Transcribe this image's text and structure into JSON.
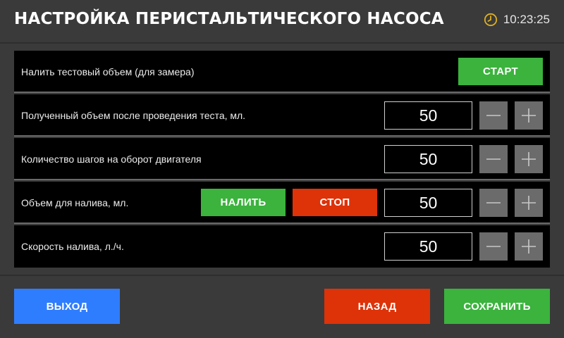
{
  "header": {
    "title": "НАСТРОЙКА ПЕРИСТАЛЬТИЧЕСКОГО НАСОСА",
    "time": "10:23:25",
    "clock_icon": "clock-icon",
    "clock_color": "#e0b020"
  },
  "rows": [
    {
      "label": "Налить тестовый объем (для замера)",
      "start_label": "СТАРТ"
    },
    {
      "label": "Полученный объем после проведения теста, мл.",
      "value": "50"
    },
    {
      "label": "Количество шагов на оборот двигателя",
      "value": "50"
    },
    {
      "label": "Объем для налива, мл.",
      "value": "50",
      "pour_label": "НАЛИТЬ",
      "stop_label": "СТОП"
    },
    {
      "label": "Скорость налива, л./ч.",
      "value": "50"
    }
  ],
  "footer": {
    "exit_label": "ВЫХОД",
    "back_label": "НАЗАД",
    "save_label": "СОХРАНИТЬ"
  },
  "colors": {
    "green": "#3bb33d",
    "red": "#de3209",
    "blue": "#2f7dff",
    "background": "#3a3a3a",
    "row_background": "#000000",
    "stepper": "#6b6b6b"
  }
}
